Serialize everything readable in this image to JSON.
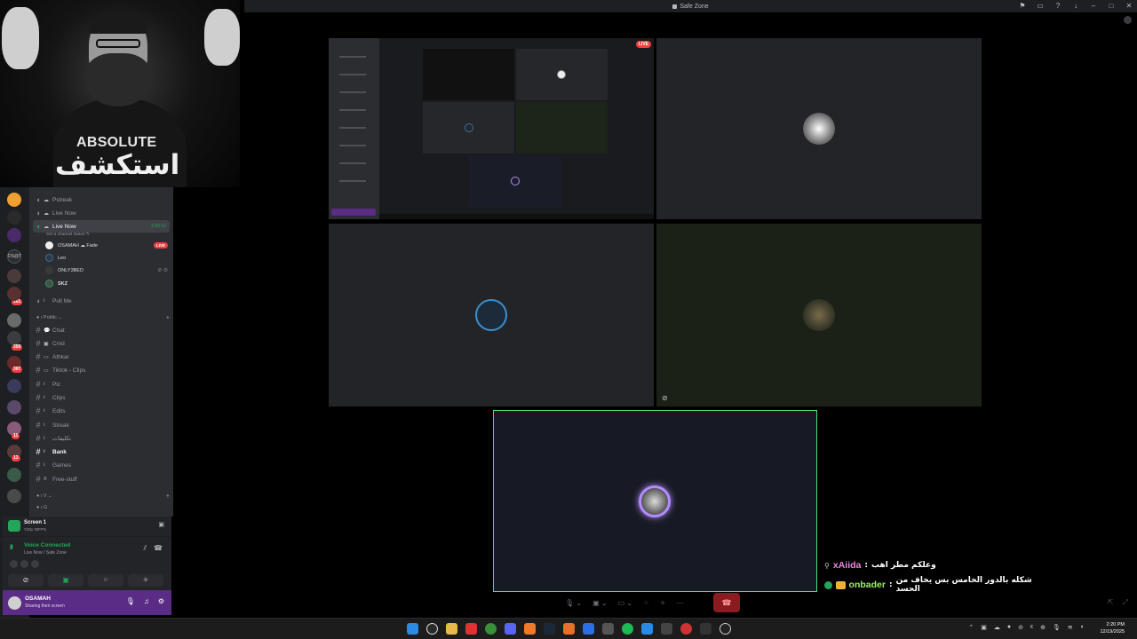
{
  "window": {
    "title": "Safe Zone",
    "title_icons": [
      "flag-icon",
      "inbox-icon",
      "help-icon",
      "download-icon",
      "minimize-icon",
      "maximize-icon",
      "close-icon"
    ]
  },
  "webcam": {
    "brand_en": "ABSOLUTE",
    "brand_ar": "استكشف"
  },
  "servers": {
    "badges": [
      "161",
      "359",
      "307",
      "11",
      "13"
    ],
    "label": "DS@T"
  },
  "channels": {
    "voice": [
      {
        "emoji": "☁",
        "label": "Pstreak"
      },
      {
        "emoji": "☁",
        "label": "Live Now"
      },
      {
        "emoji": "☁",
        "label": "Live Now",
        "time": "6:00:12"
      }
    ],
    "status_prompt": "Set a channel status ✎",
    "members": [
      {
        "name": "OSAMAH ☁ Fade",
        "live": "LIVE"
      },
      {
        "name": "Leo"
      },
      {
        "name": "ONLY3BED",
        "mic": "⊘ ⊘"
      },
      {
        "name": "SKZ"
      }
    ],
    "pull_me": "Pull Me",
    "public_category": "Public",
    "text_channels": [
      "Chat",
      "Cmd",
      "Athkar",
      "Tiktok - Clips",
      "Pic",
      "Clips",
      "Edits",
      "Streak",
      "تكليفات",
      "Bank",
      "Games",
      "Free-stuff"
    ],
    "cat_v": "V",
    "cat_g": "G"
  },
  "screen_panel": {
    "title": "Screen 1",
    "subtitle": "720p 30FPS"
  },
  "voice_panel": {
    "status": "Voice Connected",
    "location": "Live Now / Safe Zone"
  },
  "user_panel": {
    "name": "OSAMAH",
    "status": "Sharing their screen"
  },
  "stage": {
    "live_label": "LIVE"
  },
  "chat_overlay": [
    {
      "nick": "xAiida",
      "sep": " : ",
      "message": "وعلكم مطر اهب"
    },
    {
      "nick": "onbader",
      "sep": " : ",
      "message": "شكله بالدور الخامس بس يخاف من الحسد"
    }
  ],
  "clock": {
    "time": "2:20 PM",
    "date": "12/19/2025"
  },
  "colors": {
    "accent_green": "#23a55a",
    "live_red": "#f23f42",
    "user_panel_purple": "#5a2c86"
  }
}
